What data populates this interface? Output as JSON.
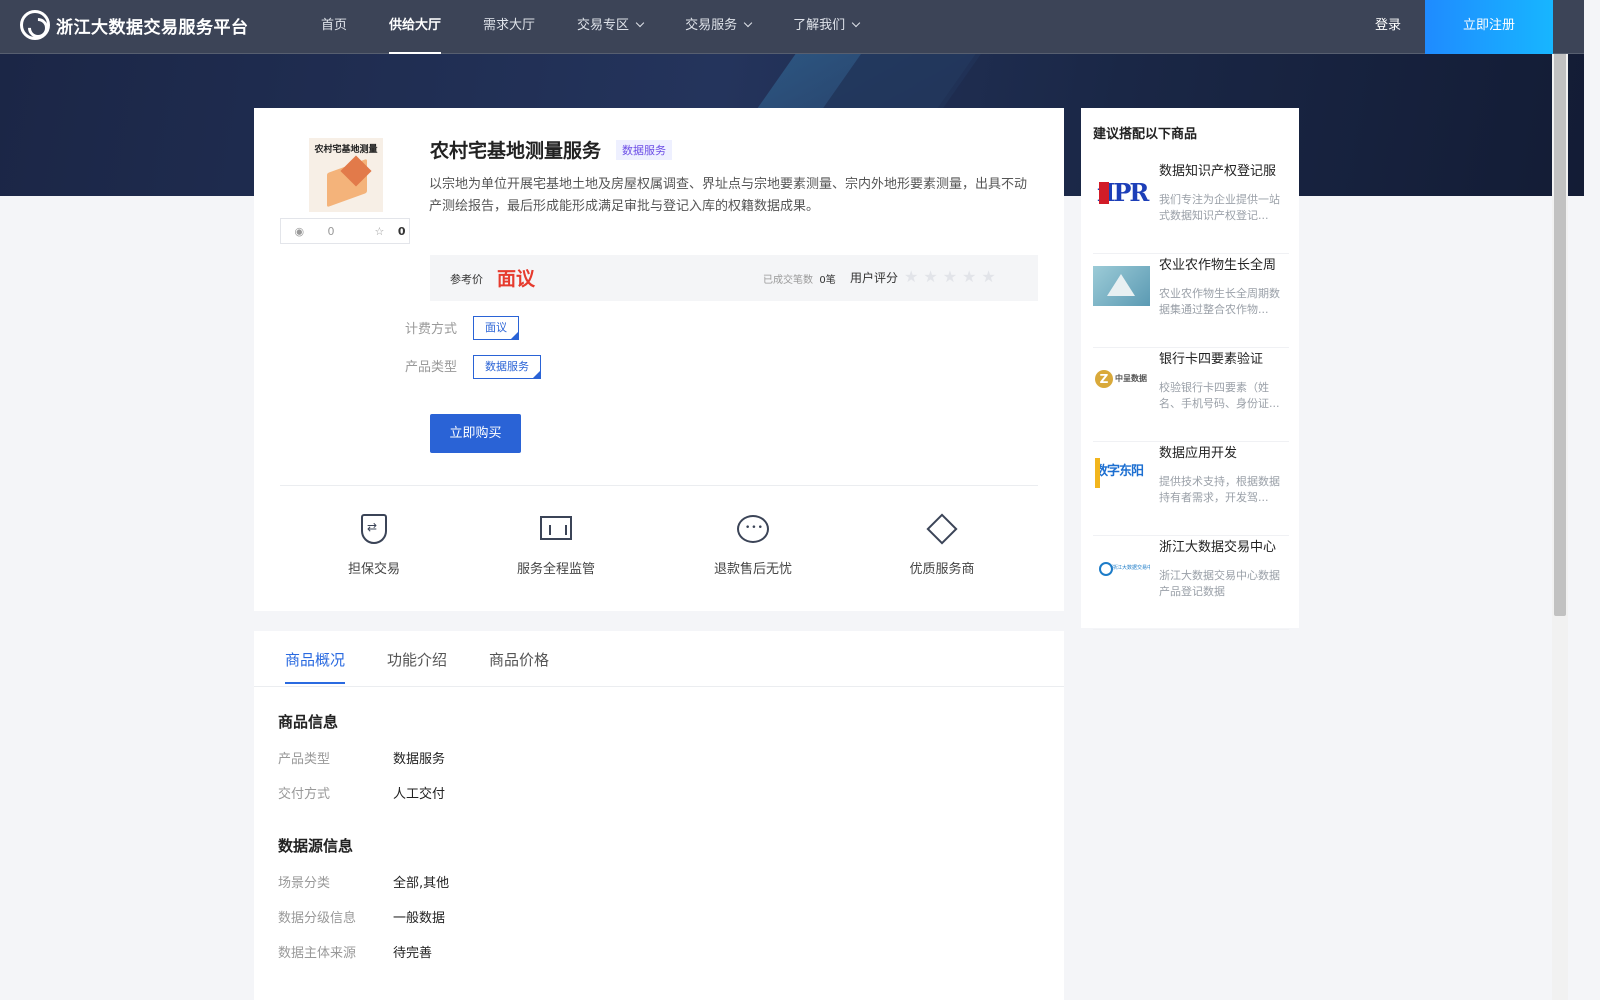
{
  "header": {
    "logo_text": "浙江大数据交易服务平台",
    "nav": [
      {
        "label": "首页"
      },
      {
        "label": "供给大厅"
      },
      {
        "label": "需求大厅"
      },
      {
        "label": "交易专区"
      },
      {
        "label": "交易服务"
      },
      {
        "label": "了解我们"
      }
    ],
    "login": "登录",
    "register": "立即注册"
  },
  "product": {
    "thumb_title": "农村宅基地测量",
    "views": "0",
    "stars": "0",
    "title": "农村宅基地测量服务",
    "tag": "数据服务",
    "description": "以宗地为单位开展宅基地土地及房屋权属调查、界址点与宗地要素测量、宗内外地形要素测量，出具不动产测绘报告，最后形成能形成满足审批与登记入库的权籍数据成果。",
    "price_label": "参考价",
    "price": "面议",
    "deal_label": "已成交笔数",
    "deal_count": "0笔",
    "rating_label": "用户评分",
    "rating_stars": "★★★★★",
    "rating_value": 0,
    "billing_label": "计费方式",
    "billing_value": "面议",
    "type_label": "产品类型",
    "type_value": "数据服务",
    "buy_label": "立即购买"
  },
  "features": [
    {
      "label": "担保交易",
      "icon": "shield-exchange-icon"
    },
    {
      "label": "服务全程监管",
      "icon": "monitor-chart-icon"
    },
    {
      "label": "退款售后无忧",
      "icon": "chat-bubble-icon"
    },
    {
      "label": "优质服务商",
      "icon": "diamond-check-icon"
    }
  ],
  "tabs": [
    {
      "label": "商品概况"
    },
    {
      "label": "功能介绍"
    },
    {
      "label": "商品价格"
    }
  ],
  "info": {
    "section1_title": "商品信息",
    "rows1": [
      {
        "k": "产品类型",
        "v": "数据服务"
      },
      {
        "k": "交付方式",
        "v": "人工交付"
      }
    ],
    "section2_title": "数据源信息",
    "rows2": [
      {
        "k": "场景分类",
        "v": "全部,其他"
      },
      {
        "k": "数据分级信息",
        "v": "一般数据"
      },
      {
        "k": "数据主体来源",
        "v": "待完善"
      }
    ]
  },
  "sidebar": {
    "title": "建议搭配以下商品",
    "items": [
      {
        "name": "数据知识产权登记服",
        "desc": "我们专注为企业提供一站式数据知识产权登记..."
      },
      {
        "name": "农业农作物生长全周",
        "desc": "农业农作物生长全周期数据集通过整合农作物..."
      },
      {
        "name": "银行卡四要素验证",
        "desc": "校验银行卡四要素（姓名、手机号码、身份证..."
      },
      {
        "name": "数据应用开发",
        "desc": "提供技术支持，根据数据持有者需求，开发驾..."
      },
      {
        "name": "浙江大数据交易中心",
        "desc": "浙江大数据交易中心数据产品登记数据"
      }
    ]
  },
  "colors": {
    "primary": "#2a63d6",
    "price_red": "#e63b2e",
    "header_bg": "#3c4457",
    "register_blue": "#1f8bff"
  }
}
